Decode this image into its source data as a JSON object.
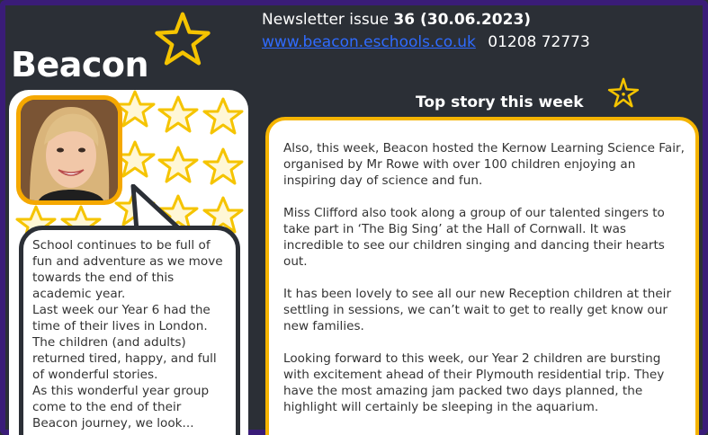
{
  "header": {
    "logo_text": "Beacon",
    "issue_prefix": "Newsletter issue",
    "issue_number": "36 (30.06.2023)",
    "website": "www.beacon.eschools.co.uk",
    "phone": "01208 72773",
    "top_story_heading": "Top story this week"
  },
  "left_panel": {
    "photo_alt": "Headteacher portrait",
    "message": [
      "School continues to be full of fun and adventure as we move towards the end of this academic year.",
      "Last week our Year 6  had the time of their lives in London.  The children (and adults) returned tired, happy, and full of wonderful stories.",
      "As this wonderful year group come to the end of their Beacon journey, we look..."
    ]
  },
  "top_story": {
    "paragraphs": [
      "Also, this week,  Beacon hosted the Kernow Learning Science Fair, organised by Mr Rowe with over 100 children enjoying an inspiring day of science and fun.",
      "Miss Clifford also took along a group of our talented singers to take part in ‘The Big Sing’ at the Hall of Cornwall.  It was incredible to see our children singing and dancing their hearts out.",
      "It has been lovely to see all our new Reception children at their settling in sessions,  we can’t wait to get to really get know our new families.",
      "Looking forward to this week, our Year 2 children are bursting with excitement ahead of their Plymouth residential trip.  They have the most amazing jam packed two days planned, the highlight will certainly be sleeping in the aquarium."
    ]
  },
  "colors": {
    "background": "#2b2f36",
    "frame": "#3a1c78",
    "accent_yellow": "#f5b400",
    "link_blue": "#2f6bff"
  },
  "icons": {
    "logo_star": "star-outline-icon",
    "heading_star": "sparkle-star-icon"
  }
}
